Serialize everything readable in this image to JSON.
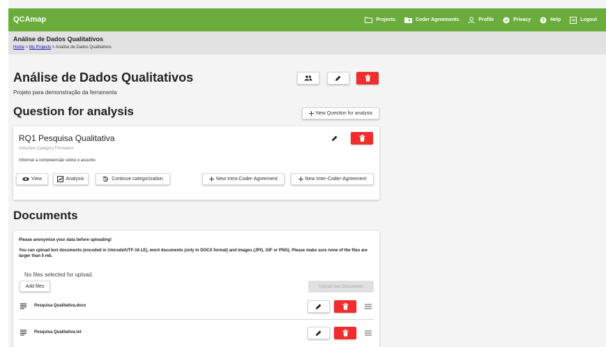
{
  "app": {
    "brand": "QCAmap",
    "nav": {
      "projects": "Projects",
      "coder_agreements": "Coder Agreements",
      "profile": "Profile",
      "privacy": "Privacy",
      "help": "Help",
      "logout": "Logout"
    }
  },
  "subheader": {
    "title": "Análise de Dados Qualitativos",
    "breadcrumb": {
      "home": "Home",
      "sep1": " > ",
      "my_projects": "My Projects",
      "sep2": " > ",
      "current": "Análise de Dados Qualitativos"
    }
  },
  "project": {
    "title": "Análise de Dados Qualitativos",
    "description": "Projeto para demonstração da ferramenta"
  },
  "questions": {
    "heading": "Question for analysis",
    "new_button": "New Question for analysis",
    "items": [
      {
        "title": "RQ1 Pesquisa Qualitativa",
        "type": "Inductive Category Formation",
        "description": "Informar a compreensão sobre o assunto",
        "actions": {
          "view": "View",
          "analysis": "Analysis",
          "continue": "Continue categorization",
          "intra": "New Intra-Coder-Agreement",
          "inter": "New Inter-Coder-Agreement"
        }
      }
    ]
  },
  "documents": {
    "heading": "Documents",
    "warning": "Please anonymise your data before uploading!",
    "info": "You can upload text documents (encoded in Unicode/UTF-16 LE), word documents (only in DOCX format) and images (JPG, GIF or PNG). Please make sure none of the files are larger than 5 mb.",
    "no_files": "No files selected for upload.",
    "add_files": "Add files",
    "upload": "Upload new Documents",
    "files": [
      {
        "name": "Pesquisa Qualitativa.docx"
      },
      {
        "name": "Pesquisa Qualitativa.txt"
      }
    ]
  },
  "colors": {
    "brand_green": "#6aad3d",
    "danger_red": "#f02d2d"
  }
}
